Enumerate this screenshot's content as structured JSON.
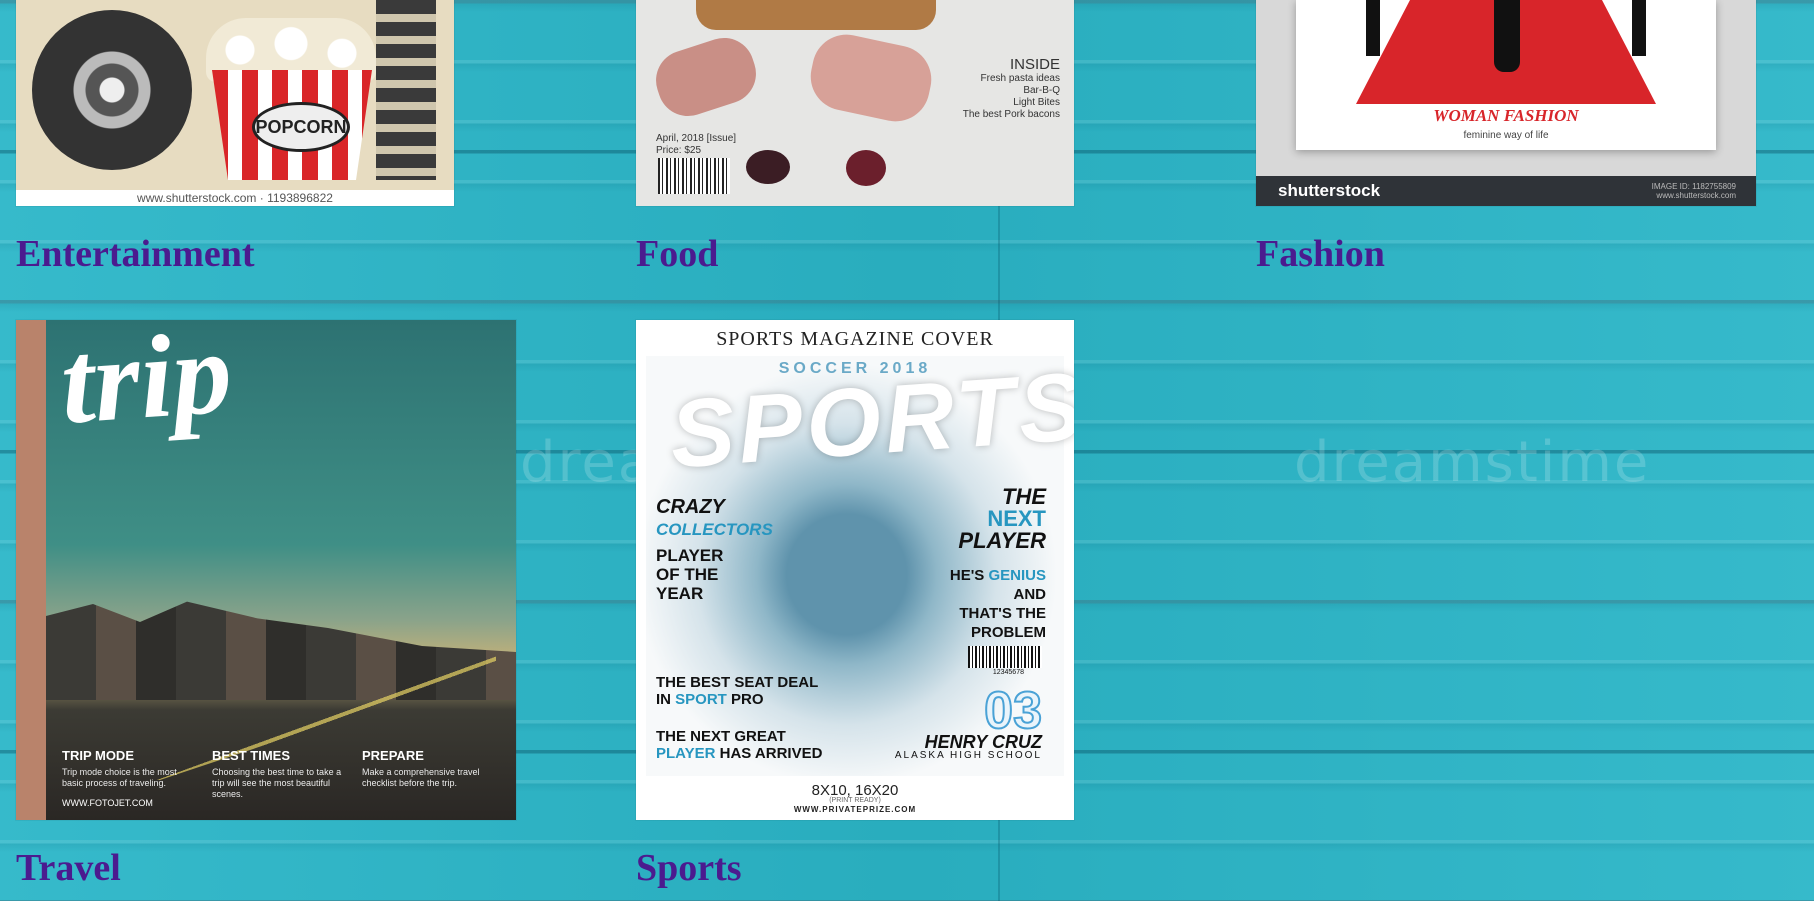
{
  "categories": [
    {
      "id": "entertainment",
      "label": "Entertainment"
    },
    {
      "id": "food",
      "label": "Food"
    },
    {
      "id": "fashion",
      "label": "Fashion"
    },
    {
      "id": "travel",
      "label": "Travel"
    },
    {
      "id": "sports",
      "label": "Sports"
    }
  ],
  "covers": {
    "entertainment": {
      "sign": "POPCORN",
      "footer": "www.shutterstock.com · 1193896822"
    },
    "food": {
      "inside_title": "INSIDE",
      "inside_lines": [
        "Fresh pasta ideas",
        "Bar-B-Q",
        "Light Bites",
        "The best Pork bacons"
      ],
      "issue": "April, 2018 [Issue]",
      "price": "Price: $25"
    },
    "fashion": {
      "title": "WOMAN FASHION",
      "subtitle": "feminine way of life",
      "brand": "shutterstock",
      "image_id": "IMAGE ID: 1182755809",
      "site": "www.shutterstock.com"
    },
    "travel": {
      "title": "trip",
      "columns": [
        {
          "heading": "TRIP MODE",
          "text": "Trip mode choice is the most basic process of traveling."
        },
        {
          "heading": "BEST TIMES",
          "text": "Choosing the best time to take a trip will see the most beautiful scenes."
        },
        {
          "heading": "PREPARE",
          "text": "Make a comprehensive travel checklist before the trip."
        }
      ],
      "url": "WWW.FOTOJET.COM"
    },
    "sports": {
      "header": "SPORTS MAGAZINE COVER",
      "season": "SOCCER 2018",
      "big": "SPORTS",
      "crazy": "CRAZY",
      "collectors": "COLLECTORS",
      "poy": [
        "PLAYER",
        "OF THE",
        "YEAR"
      ],
      "the": "THE",
      "next": "NEXT",
      "player": "PLAYER",
      "genius_lines": {
        "a": "HE'S ",
        "b": "GENIUS",
        "c": "AND",
        "d": "THAT'S THE",
        "e": "PROBLEM"
      },
      "barcode_num": "12345678",
      "seat": {
        "a": "THE BEST SEAT DEAL",
        "b": "IN ",
        "c": "SPORT",
        "d": " PRO"
      },
      "great": {
        "a": "THE NEXT GREAT",
        "b": "PLAYER",
        "c": " HAS ARRIVED"
      },
      "number": "03",
      "name": "HENRY CRUZ",
      "school": "ALASKA HIGH SCHOOL",
      "size": "8X10, 16X20",
      "print": "(PRINT READY)",
      "url": "WWW.PRIVATEPRIZE.COM"
    }
  },
  "watermark": "dreamstime"
}
